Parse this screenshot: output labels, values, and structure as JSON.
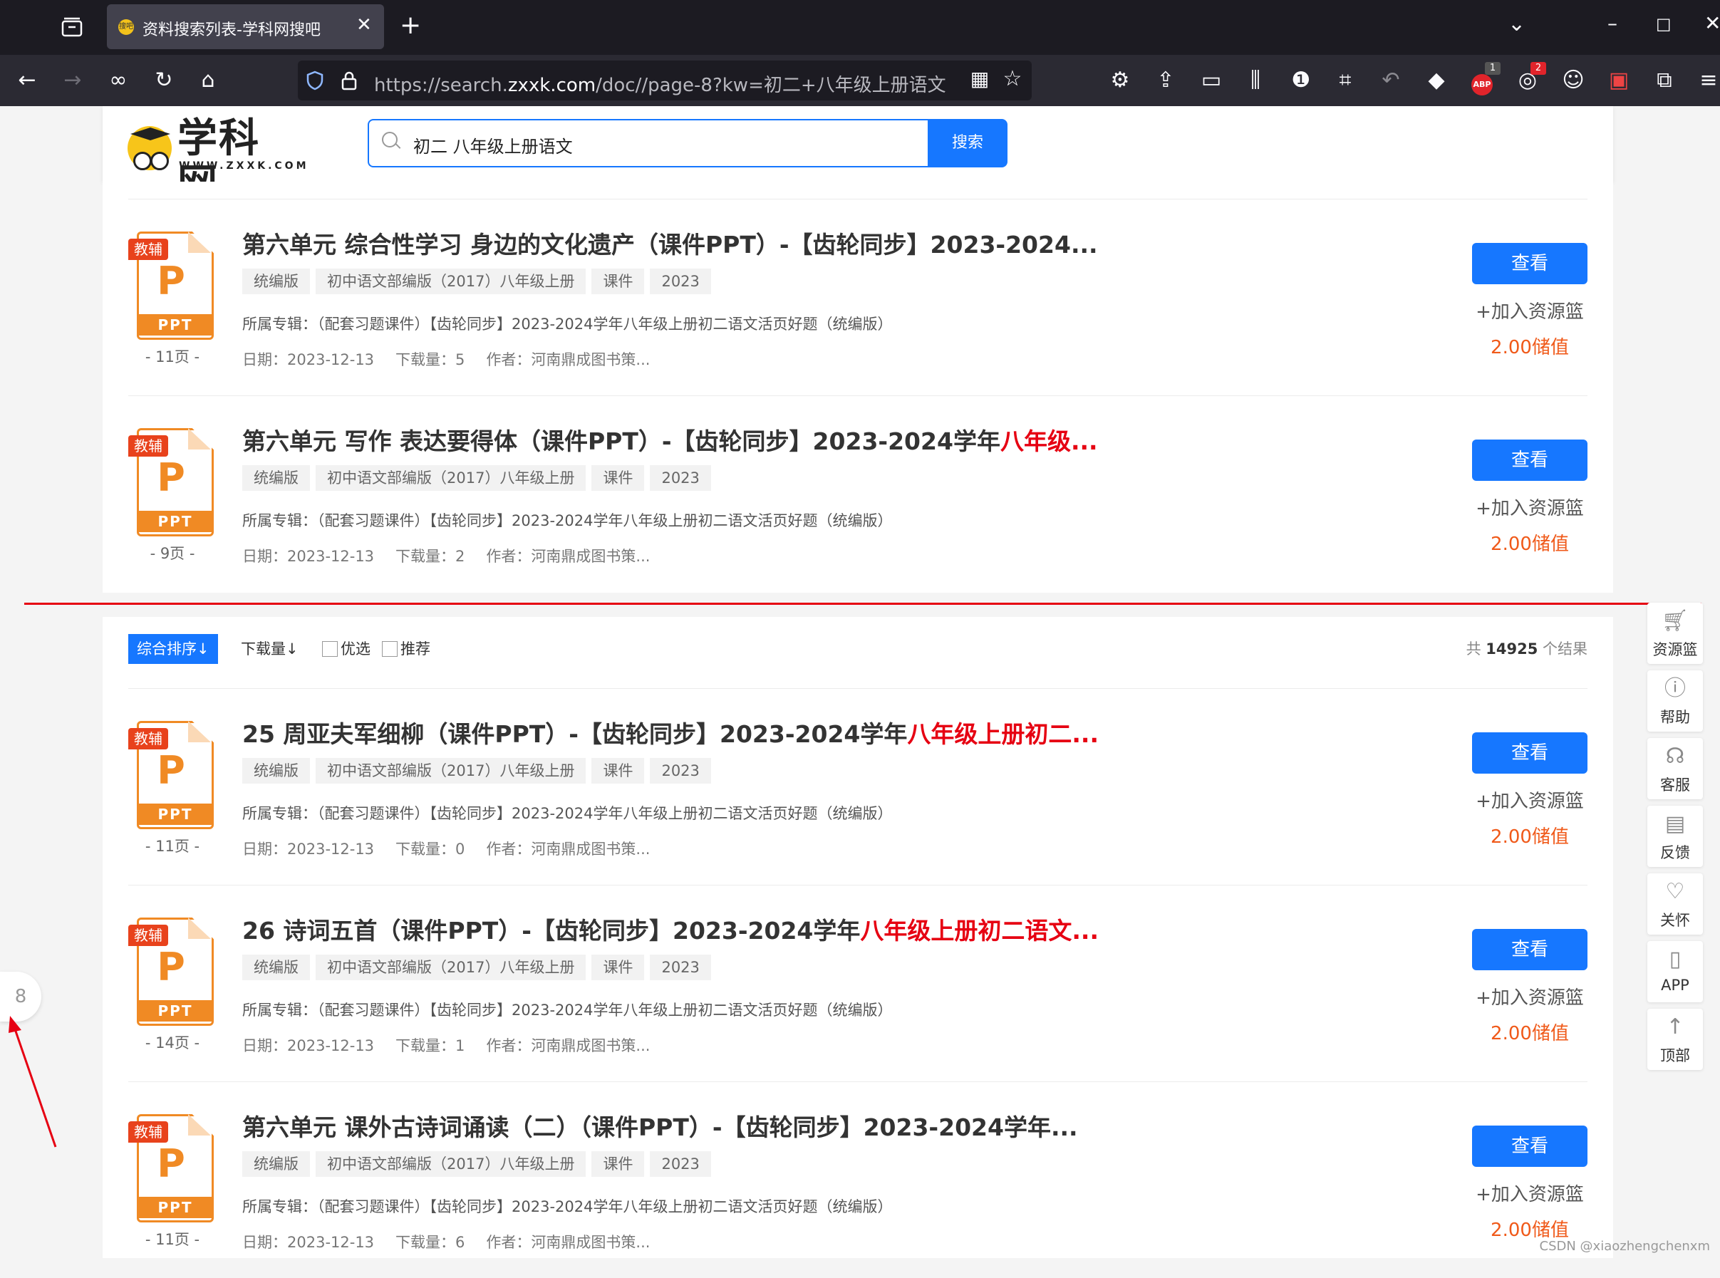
{
  "browser": {
    "tab_title": "资料搜索列表-学科网搜吧",
    "tab_favicon_text": "搜吧",
    "new_tab_label": "+",
    "url_prefix": "https://search.",
    "url_host": "zxxk.com",
    "url_rest": "/doc//page-8?kw=初二+八年级上册语文",
    "extension_badges": {
      "abp": "1",
      "ext2": "2"
    }
  },
  "header": {
    "logo_text": "学科网",
    "logo_sub": "WWW.ZXXK.COM",
    "search_value": "初二 八年级上册语文",
    "search_button": "搜索"
  },
  "results_top": [
    {
      "tag": "教辅",
      "filetype": "PPT",
      "pages": "- 11页 -",
      "title_plain": "第六单元 综合性学习 身边的文化遗产（课件PPT）-【齿轮同步】2023-2024...",
      "title_hl": "",
      "tags": [
        "统编版",
        "初中语文部编版（2017）八年级上册",
        "课件",
        "2023"
      ],
      "album": "所属专辑：（配套习题课件）【齿轮同步】2023-2024学年八年级上册初二语文活页好题（统编版）",
      "date": "日期：2023-12-13",
      "downloads": "下载量：5",
      "author": "作者：河南鼎成图书策...",
      "view": "查看",
      "add": "+加入资源篮",
      "price": "2.00储值"
    },
    {
      "tag": "教辅",
      "filetype": "PPT",
      "pages": "- 9页 -",
      "title_plain": "第六单元 写作 表达要得体（课件PPT）-【齿轮同步】2023-2024学年",
      "title_hl": "八年级...",
      "tags": [
        "统编版",
        "初中语文部编版（2017）八年级上册",
        "课件",
        "2023"
      ],
      "album": "所属专辑：（配套习题课件）【齿轮同步】2023-2024学年八年级上册初二语文活页好题（统编版）",
      "date": "日期：2023-12-13",
      "downloads": "下载量：2",
      "author": "作者：河南鼎成图书策...",
      "view": "查看",
      "add": "+加入资源篮",
      "price": "2.00储值"
    }
  ],
  "sort": {
    "active": "综合排序↓",
    "downloads": "下载量↓",
    "check1": "优选",
    "check2": "推荐",
    "count_prefix": "共",
    "count_value": "14925",
    "count_suffix": "个结果"
  },
  "results_bottom": [
    {
      "tag": "教辅",
      "filetype": "PPT",
      "pages": "- 11页 -",
      "title_plain": "25 周亚夫军细柳（课件PPT）-【齿轮同步】2023-2024学年",
      "title_hl": "八年级上册初二...",
      "tags": [
        "统编版",
        "初中语文部编版（2017）八年级上册",
        "课件",
        "2023"
      ],
      "album": "所属专辑：（配套习题课件）【齿轮同步】2023-2024学年八年级上册初二语文活页好题（统编版）",
      "date": "日期：2023-12-13",
      "downloads": "下载量：0",
      "author": "作者：河南鼎成图书策...",
      "view": "查看",
      "add": "+加入资源篮",
      "price": "2.00储值"
    },
    {
      "tag": "教辅",
      "filetype": "PPT",
      "pages": "- 14页 -",
      "title_plain": "26 诗词五首（课件PPT）-【齿轮同步】2023-2024学年",
      "title_hl": "八年级上册初二语文...",
      "tags": [
        "统编版",
        "初中语文部编版（2017）八年级上册",
        "课件",
        "2023"
      ],
      "album": "所属专辑：（配套习题课件）【齿轮同步】2023-2024学年八年级上册初二语文活页好题（统编版）",
      "date": "日期：2023-12-13",
      "downloads": "下载量：1",
      "author": "作者：河南鼎成图书策...",
      "view": "查看",
      "add": "+加入资源篮",
      "price": "2.00储值"
    },
    {
      "tag": "教辅",
      "filetype": "PPT",
      "pages": "- 11页 -",
      "title_plain": "第六单元 课外古诗词诵读（二）（课件PPT）-【齿轮同步】2023-2024学年...",
      "title_hl": "",
      "tags": [
        "统编版",
        "初中语文部编版（2017）八年级上册",
        "课件",
        "2023"
      ],
      "album": "所属专辑：（配套习题课件）【齿轮同步】2023-2024学年八年级上册初二语文活页好题（统编版）",
      "date": "日期：2023-12-13",
      "downloads": "下载量：6",
      "author": "作者：河南鼎成图书策...",
      "view": "查看",
      "add": "+加入资源篮",
      "price": "2.00储值"
    }
  ],
  "rail": [
    {
      "label": "资源篮",
      "icon": "cart-icon"
    },
    {
      "label": "帮助",
      "icon": "help-icon"
    },
    {
      "label": "客服",
      "icon": "headset-icon"
    },
    {
      "label": "反馈",
      "icon": "feedback-icon"
    },
    {
      "label": "关怀",
      "icon": "care-icon"
    },
    {
      "label": "APP",
      "icon": "phone-icon"
    },
    {
      "label": "顶部",
      "icon": "arrow-up-icon"
    }
  ],
  "page_indicator": "8",
  "watermark": "CSDN @xiaozhengchenxm",
  "colors": {
    "primary": "#1677ff",
    "highlight": "#e60012",
    "price": "#f05a1a",
    "ppt": "#f08a24"
  }
}
